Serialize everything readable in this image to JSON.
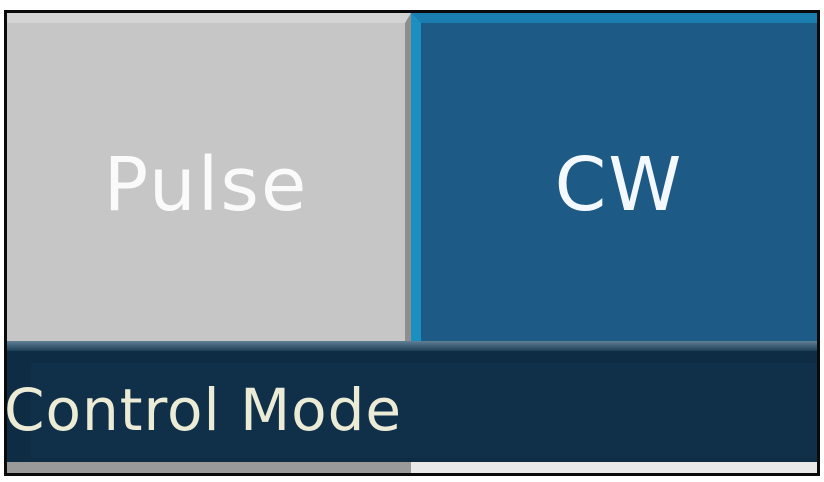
{
  "control_mode": {
    "label": "Control Mode",
    "options": [
      {
        "label": "Pulse",
        "selected": false
      },
      {
        "label": "CW",
        "selected": true
      }
    ],
    "selected": "CW"
  },
  "colors": {
    "selected_bg": "#1e5a86",
    "unselected_bg": "#c6c6c6",
    "panel_bg": "#0d2c44",
    "label_text": "#ececd6"
  }
}
